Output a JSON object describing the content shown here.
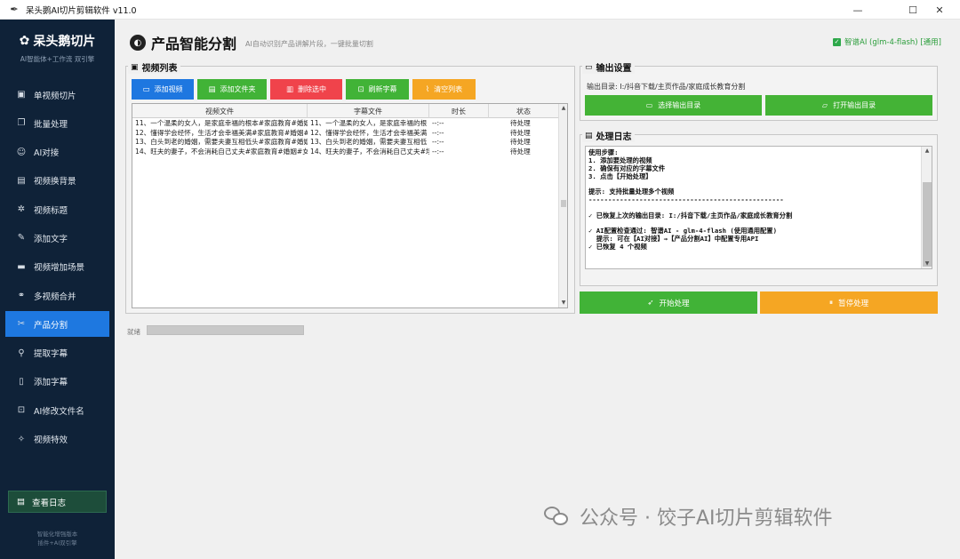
{
  "window": {
    "title": "呆头鹅AI切片剪辑软件 v11.0",
    "app_icon": "feather-icon",
    "controls": [
      "minimize-icon",
      "maximize-icon",
      "close-icon"
    ]
  },
  "sidebar": {
    "brand_title": "呆头鹅切片",
    "brand_subtitle": "AI智能体+工作流 双引擎",
    "items": [
      {
        "label": "单视频切片",
        "icon": "video-icon"
      },
      {
        "label": "批量处理",
        "icon": "copy-icon"
      },
      {
        "label": "AI对接",
        "icon": "robot-icon"
      },
      {
        "label": "视频换背景",
        "icon": "image-icon"
      },
      {
        "label": "视频标题",
        "icon": "gear-icon"
      },
      {
        "label": "添加文字",
        "icon": "pen-icon"
      },
      {
        "label": "视频增加场景",
        "icon": "film-icon"
      },
      {
        "label": "多视频合并",
        "icon": "link-icon"
      },
      {
        "label": "产品分割",
        "icon": "scissors-icon",
        "active": true
      },
      {
        "label": "提取字幕",
        "icon": "clip-icon"
      },
      {
        "label": "添加字幕",
        "icon": "doc-icon"
      },
      {
        "label": "AI修改文件名",
        "icon": "rename-icon"
      },
      {
        "label": "视频特效",
        "icon": "sparkle-icon"
      }
    ],
    "log_button": "查看日志",
    "footer_line1": "智能化增强版本",
    "footer_line2": "插件+AI双引擎"
  },
  "header": {
    "title": "产品智能分割",
    "subtitle": "AI自动识别产品讲解片段，一键批量切割",
    "ai_status": "智谱AI (glm-4-flash) [通用]"
  },
  "video_list": {
    "title": "视频列表",
    "buttons": [
      {
        "label": "添加视频",
        "color": "#1e77e0"
      },
      {
        "label": "添加文件夹",
        "color": "#41b337"
      },
      {
        "label": "删除选中",
        "color": "#f0434b"
      },
      {
        "label": "刷新字幕",
        "color": "#41b337"
      },
      {
        "label": "清空列表",
        "color": "#f5a623"
      }
    ],
    "columns": [
      "视频文件",
      "字幕文件",
      "时长",
      "状态"
    ],
    "rows": [
      [
        "11、一个温柔的女人，是家庭幸福的根本#家庭教育#婚姻",
        "11、一个温柔的女人，是家庭幸福的根",
        "--:--",
        "待处理"
      ],
      [
        "12、懂得学会经怀，生活才会幸福美满#家庭教育#婚姻#",
        "12、懂得学会经怀，生活才会幸福美满",
        "--:--",
        "待处理"
      ],
      [
        "13、白头到老的婚姻，需要夫妻互相低头#家庭教育#婚姻",
        "13、白头到老的婚姻，需要夫妻互相低",
        "--:--",
        "待处理"
      ],
      [
        "14、旺夫的妻子，不会消耗自己丈夫#家庭教育#婚姻#女",
        "14、旺夫的妻子，不会消耗自己丈夫#场",
        "--:--",
        "待处理"
      ]
    ]
  },
  "output": {
    "title": "输出设置",
    "dir_label": "输出目录:",
    "dir_value": "I:/抖音下载/主页作品/家庭成长教育分割",
    "select_button": "选择输出目录",
    "open_button": "打开输出目录"
  },
  "log": {
    "title": "处理日志",
    "lines": [
      "使用步骤:",
      "1. 添加要处理的视频",
      "2. 确保有对应的字幕文件",
      "3. 点击【开始处理】",
      "",
      "提示: 支持批量处理多个视频",
      "--------------------------------------------------",
      "",
      "✓ 已恢复上次的输出目录: I:/抖音下载/主页作品/家庭成长教育分割",
      "",
      "✓ AI配置检查通过: 智谱AI - glm-4-flash (使用通用配置)",
      "  提示: 可在【AI对接】→【产品分割AI】中配置专用API",
      "✓ 已恢复 4 个视频"
    ]
  },
  "actions": {
    "start": "开始处理",
    "pause": "暂停处理"
  },
  "status": {
    "label": "就绪",
    "progress": 1.0
  },
  "watermark": {
    "text": "公众号 · 饺子AI切片剪辑软件"
  }
}
